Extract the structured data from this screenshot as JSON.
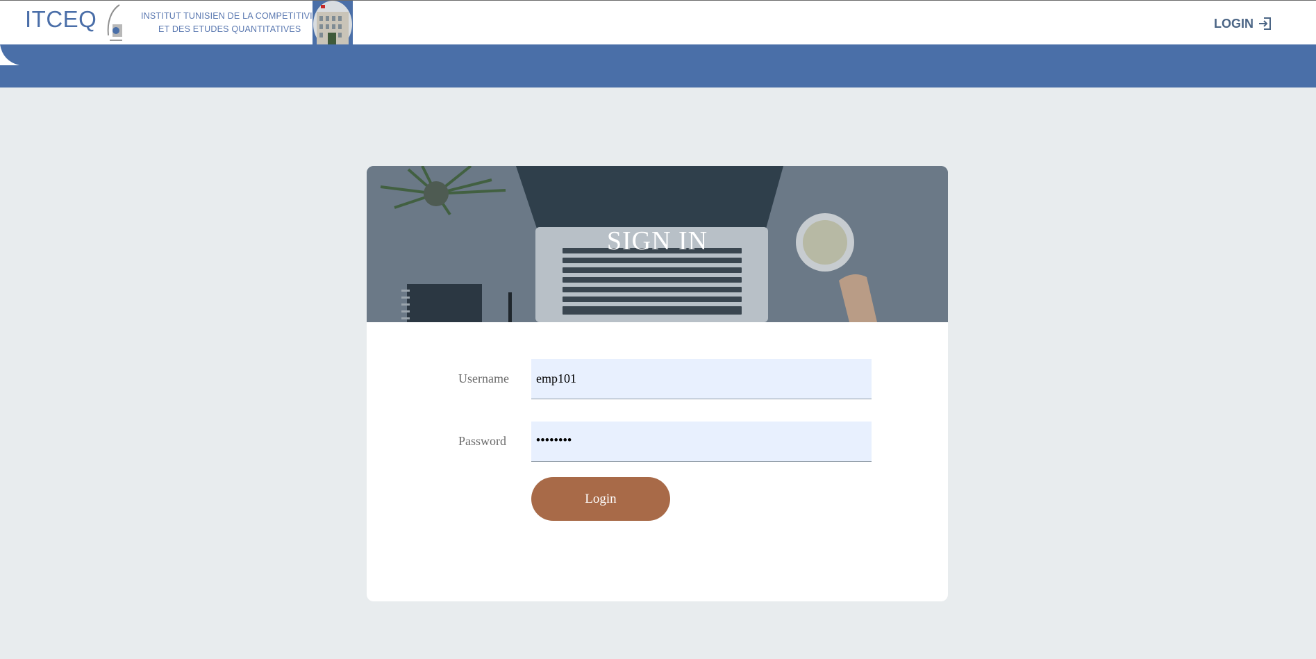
{
  "header": {
    "brand": "ITCEQ",
    "institute_line1": "INSTITUT TUNISIEN DE LA COMPETITIVITE",
    "institute_line2": "ET DES ETUDES QUANTITATIVES",
    "login_link": "LOGIN",
    "login_icon": "sign-in-icon"
  },
  "card": {
    "title": "SIGN IN",
    "username": {
      "label": "Username",
      "value": "emp101"
    },
    "password": {
      "label": "Password",
      "masked_value": "••••••••"
    },
    "submit_label": "Login"
  },
  "colors": {
    "brand_blue": "#4a6fa8",
    "button": "#a86a48",
    "background": "#e8ecee",
    "input_fill": "#e8f0fe"
  }
}
